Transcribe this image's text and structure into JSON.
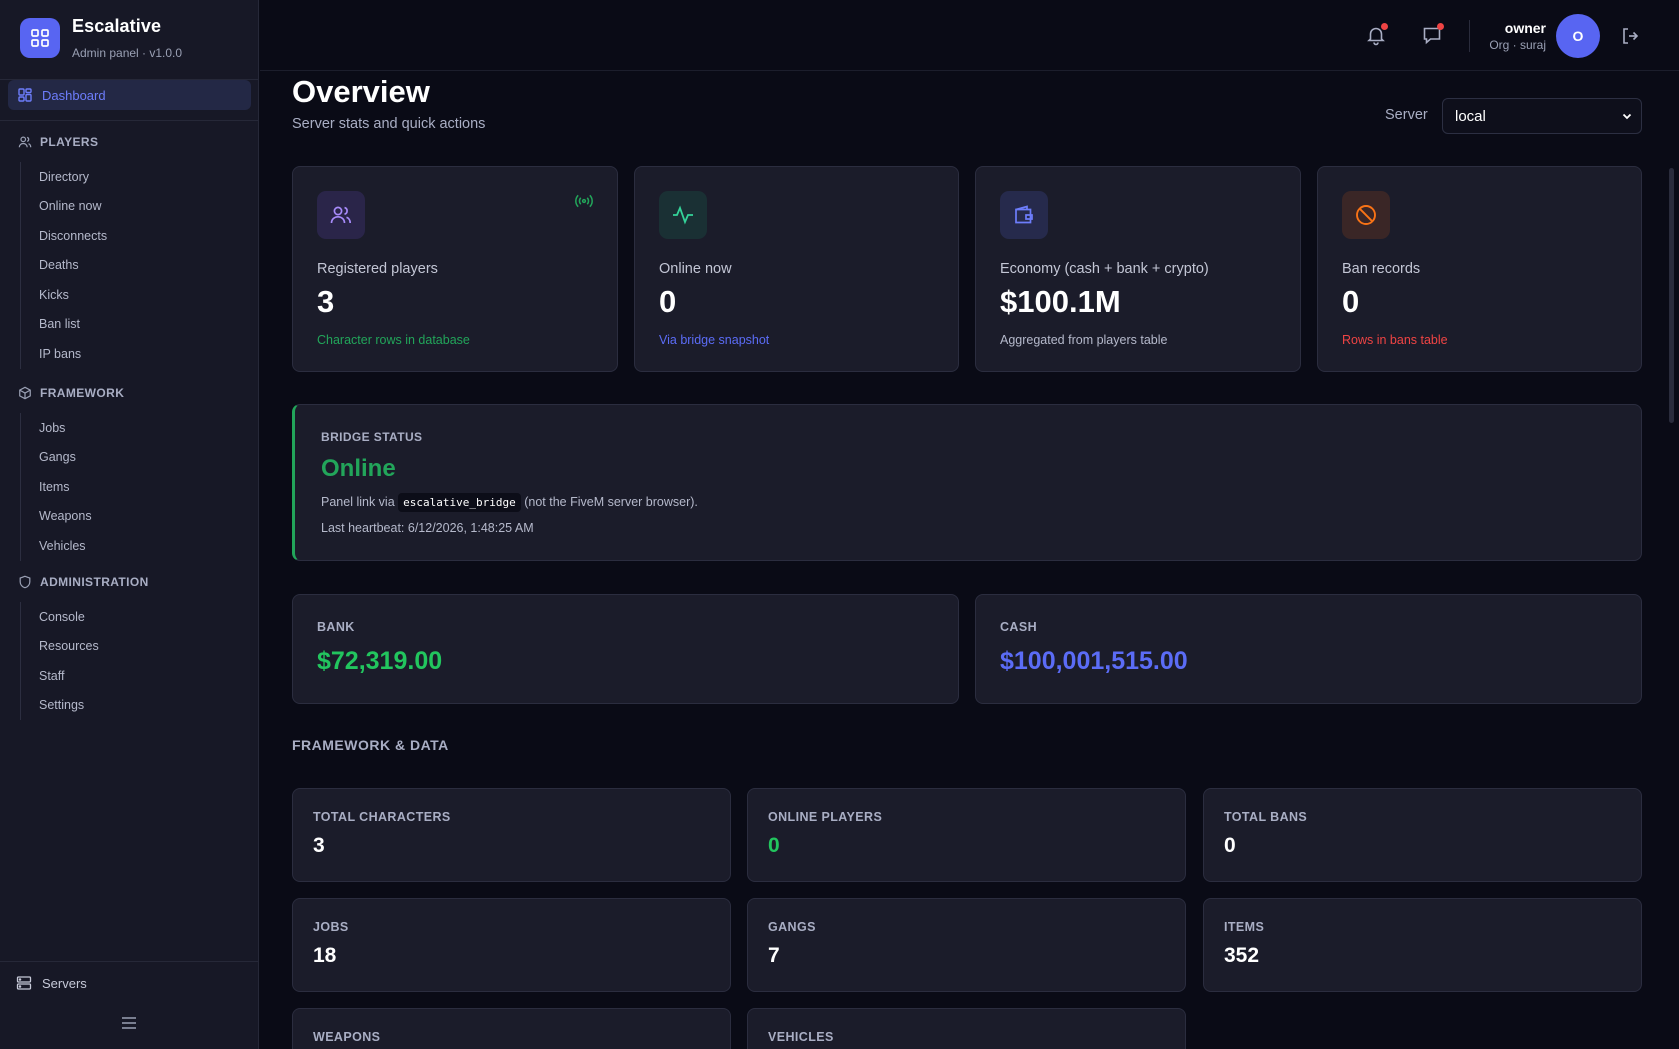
{
  "brand": {
    "name": "Escalative",
    "subtitle": "Admin panel · v1.0.0"
  },
  "sidebar": {
    "dashboard": "Dashboard",
    "sections": [
      {
        "title": "PLAYERS",
        "icon": "users-icon",
        "items": [
          "Directory",
          "Online now",
          "Disconnects",
          "Deaths",
          "Kicks",
          "Ban list",
          "IP bans"
        ]
      },
      {
        "title": "FRAMEWORK",
        "icon": "cube-icon",
        "items": [
          "Jobs",
          "Gangs",
          "Items",
          "Weapons",
          "Vehicles"
        ]
      },
      {
        "title": "ADMINISTRATION",
        "icon": "shield-icon",
        "items": [
          "Console",
          "Resources",
          "Staff",
          "Settings"
        ]
      }
    ],
    "servers": "Servers"
  },
  "header": {
    "user_name": "owner",
    "user_org": "Org · suraj",
    "avatar_initial": "O"
  },
  "page": {
    "title": "Overview",
    "subtitle": "Server stats and quick actions",
    "server_label": "Server",
    "server_value": "local"
  },
  "stats": [
    {
      "label": "Registered players",
      "value": "3",
      "note": "Character rows in database",
      "note_color": "#22a55a",
      "icon": "users-icon",
      "icon_color": "#a78bfa",
      "icon_bg": "#2a2549"
    },
    {
      "label": "Online now",
      "value": "0",
      "note": "Via bridge snapshot",
      "note_color": "#5b6cf6",
      "icon": "activity-icon",
      "icon_color": "#34d399",
      "icon_bg": "#1a3034"
    },
    {
      "label": "Economy (cash + bank + crypto)",
      "value": "$100.1M",
      "note": "Aggregated from players table",
      "note_color": "#b5b9cb",
      "icon": "wallet-icon",
      "icon_color": "#6d7dfb",
      "icon_bg": "#262a4c"
    },
    {
      "label": "Ban records",
      "value": "0",
      "note": "Rows in bans table",
      "note_color": "#ef4444",
      "icon": "ban-icon",
      "icon_color": "#f97316",
      "icon_bg": "#3a2626"
    }
  ],
  "bridge": {
    "heading": "BRIDGE STATUS",
    "status": "Online",
    "link_prefix": "Panel link via",
    "link_code": "escalative_bridge",
    "link_suffix": "(not the FiveM server browser).",
    "heartbeat": "Last heartbeat: 6/12/2026, 1:48:25 AM"
  },
  "money": [
    {
      "label": "BANK",
      "value": "$72,319.00",
      "color": "#22c55e"
    },
    {
      "label": "CASH",
      "value": "$100,001,515.00",
      "color": "#5b6cf6"
    }
  ],
  "framework": {
    "title": "FRAMEWORK & DATA",
    "cards": [
      {
        "label": "TOTAL CHARACTERS",
        "value": "3"
      },
      {
        "label": "ONLINE PLAYERS",
        "value": "0"
      },
      {
        "label": "TOTAL BANS",
        "value": "0"
      },
      {
        "label": "JOBS",
        "value": "18"
      },
      {
        "label": "GANGS",
        "value": "7"
      },
      {
        "label": "ITEMS",
        "value": "352"
      },
      {
        "label": "WEAPONS",
        "value": ""
      },
      {
        "label": "VEHICLES",
        "value": ""
      }
    ]
  }
}
